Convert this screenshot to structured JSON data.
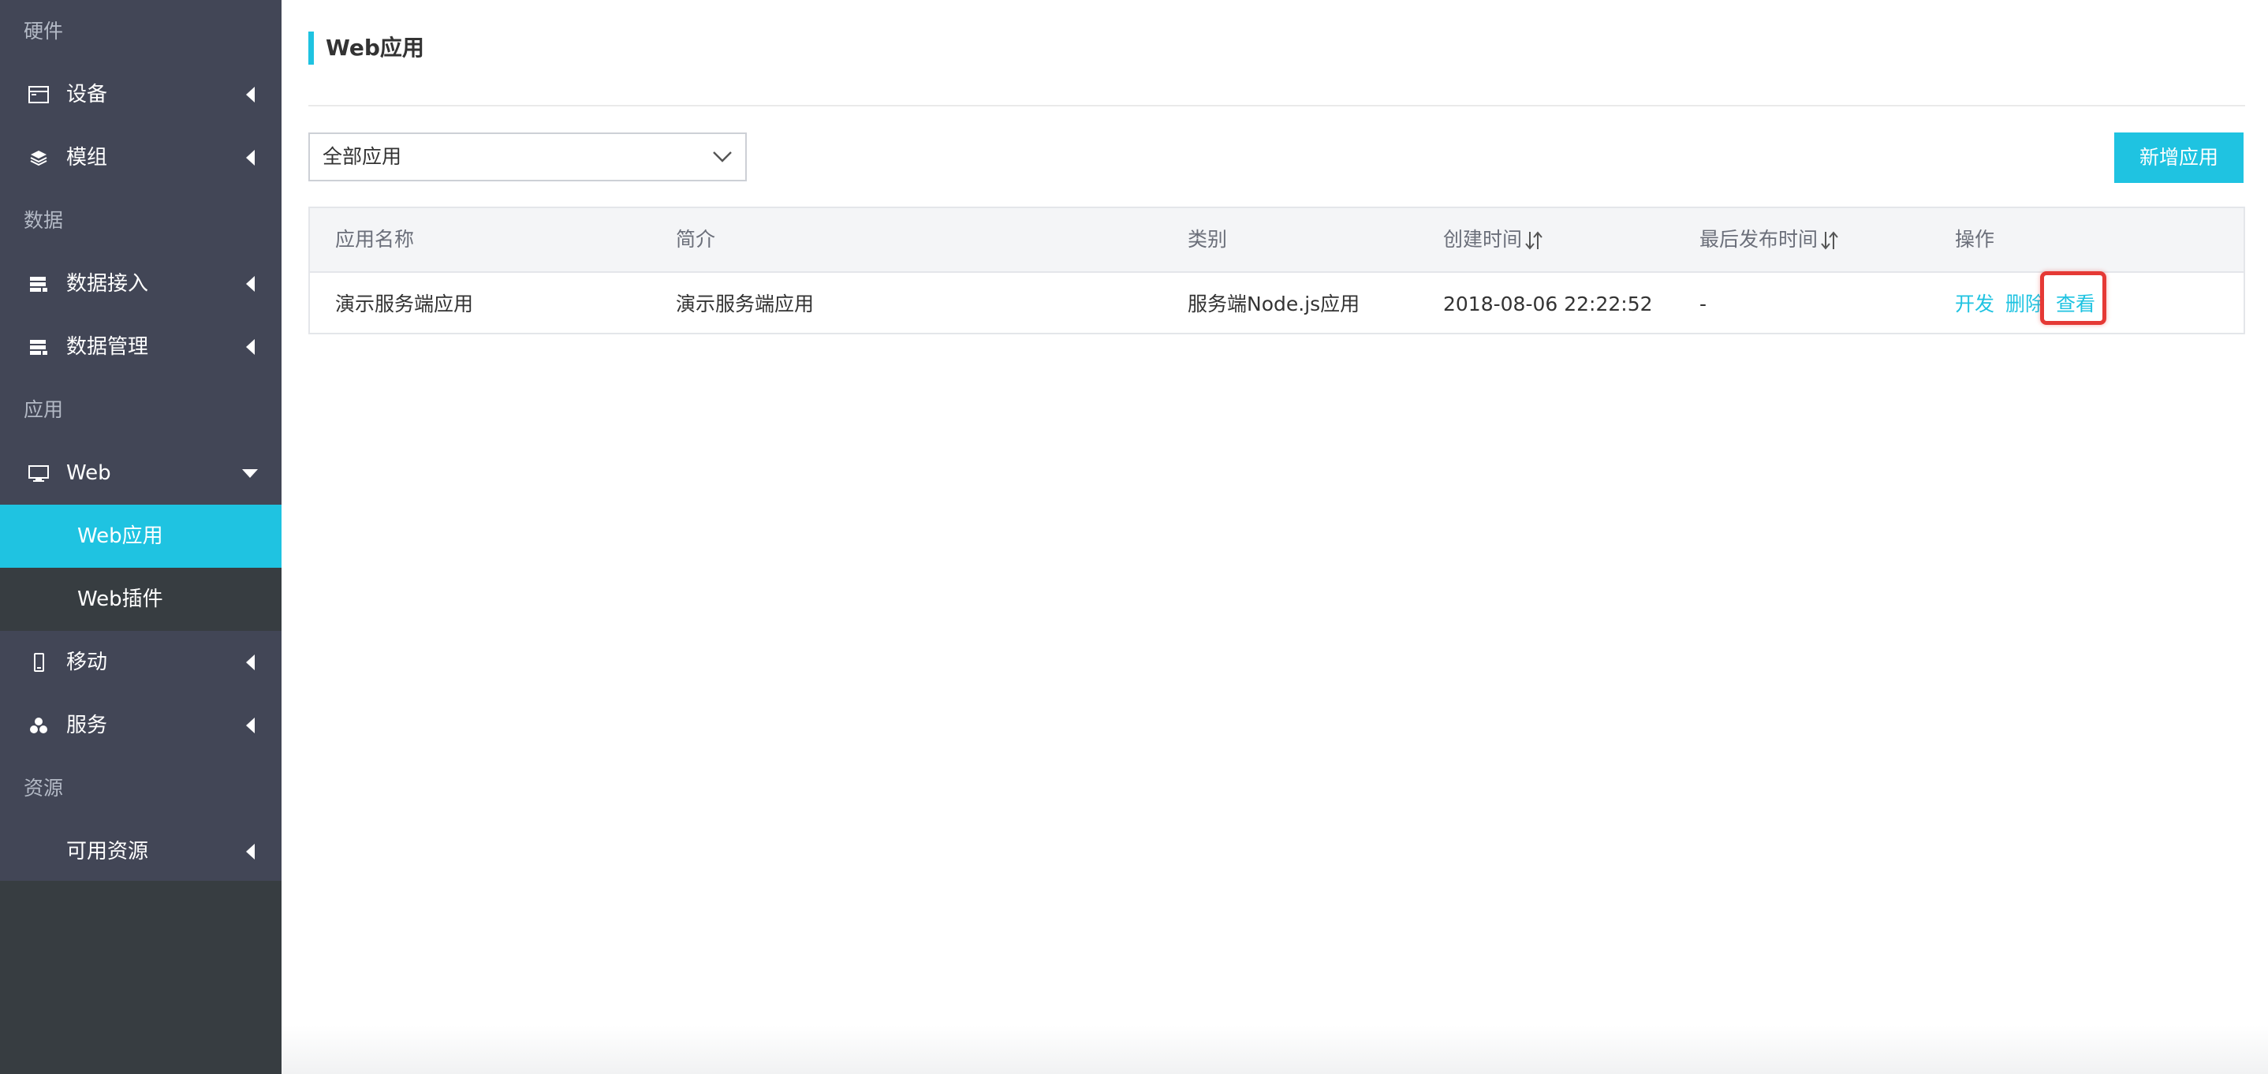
{
  "sidebar": {
    "groups": {
      "hardware": "硬件",
      "data": "数据",
      "app": "应用",
      "resource": "资源"
    },
    "items": {
      "device": "设备",
      "module": "模组",
      "data_access": "数据接入",
      "data_manage": "数据管理",
      "web": "Web",
      "web_app": "Web应用",
      "web_plugin": "Web插件",
      "mobile": "移动",
      "service": "服务",
      "available_resource": "可用资源"
    }
  },
  "main": {
    "title": "Web应用",
    "filter": {
      "selected": "全部应用"
    },
    "add_button": "新增应用",
    "table": {
      "headers": {
        "name": "应用名称",
        "desc": "简介",
        "category": "类别",
        "created": "创建时间",
        "published": "最后发布时间",
        "actions": "操作"
      },
      "rows": [
        {
          "name": "演示服务端应用",
          "desc": "演示服务端应用",
          "category": "服务端Node.js应用",
          "created": "2018-08-06 22:22:52",
          "published": "-",
          "action_dev": "开发",
          "action_delete": "删除",
          "action_view": "查看"
        }
      ]
    }
  },
  "colors": {
    "accent": "#1fc3e1",
    "sidebar_bg": "#424656",
    "highlight": "#e53935"
  }
}
